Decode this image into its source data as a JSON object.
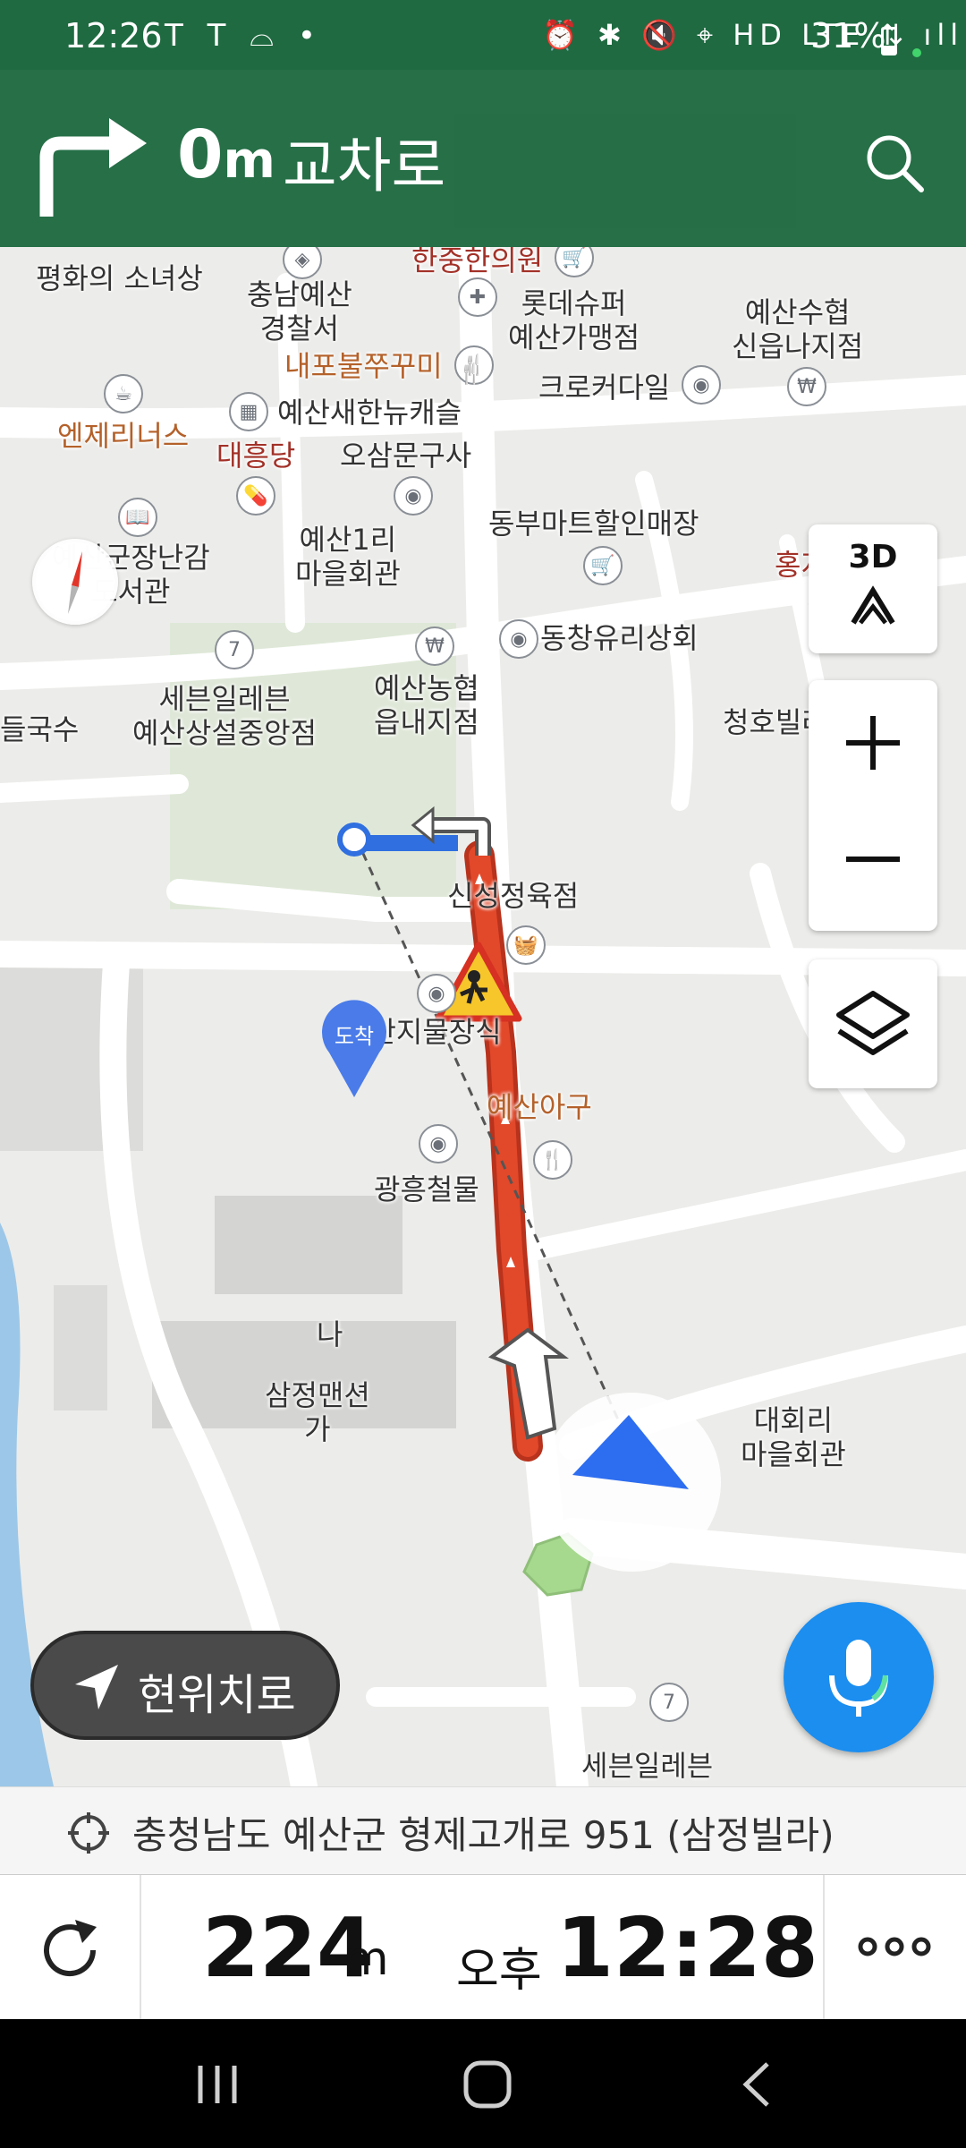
{
  "status_bar": {
    "time": "12:26",
    "notification_icons": "T T ⌓ •",
    "system_icons": "⏰ ✱ 🔇 ⌖ HD LTE ⇅ ıll",
    "battery": "31%"
  },
  "nav_header": {
    "distance_value": "0",
    "distance_unit": "m",
    "road_name": "교차로",
    "turn_icon": "turn-right-icon",
    "search_icon": "search-icon"
  },
  "map": {
    "labels": {
      "pyeonghwa": "평화의 소녀상",
      "chungnam_police": "충남예산\n경찰서",
      "hanjung": "한중한의원",
      "lotte": "롯데슈퍼\n예산가맹점",
      "yesan_sinup": "예산수협\n신읍나지점",
      "naepo": "내포불쭈꾸미",
      "crocodile": "크로커다일",
      "hanu": "예산새한뉴캐슬",
      "enjer": "엔제리너스",
      "daeheung": "대흥당",
      "osam": "오삼문구사",
      "dongbu": "동부마트할인매장",
      "library": "예산군장난감\n도서관",
      "maeul1": "예산1리\n마을회관",
      "hongjiu": "홍지우의원",
      "dongchang": "동창유리상회",
      "seven1": "세븐일레븐\n예산상설중앙점",
      "nonghyup": "예산농협\n읍내지점",
      "guksu": "들국수",
      "cheongho": "청호빌라",
      "shinsung": "신성정육점",
      "jimul": "예산지물장식",
      "agu": "예산아구",
      "gwangheung": "광흥철물",
      "samjeong": "삼정맨션\n가",
      "na": "나",
      "daehoe": "대회리\n마을회관",
      "seven2": "세븐일레븐",
      "dest_pin": "도착"
    },
    "controls": {
      "view_3d": "3D",
      "zoom_in": "+",
      "zoom_out": "−"
    },
    "current_location_btn": "현위치로"
  },
  "address_bar": {
    "address": "충청남도 예산군 형제고개로 951 (삼정빌라)"
  },
  "bottom_bar": {
    "remaining_distance": "224",
    "remaining_unit": "m",
    "ampm": "오후",
    "eta": "12:28"
  },
  "colors": {
    "header_green": "#1f6a41",
    "route_red": "#e2482a",
    "route_blue": "#2f6fe0",
    "mic_blue": "#1b8ef0"
  }
}
